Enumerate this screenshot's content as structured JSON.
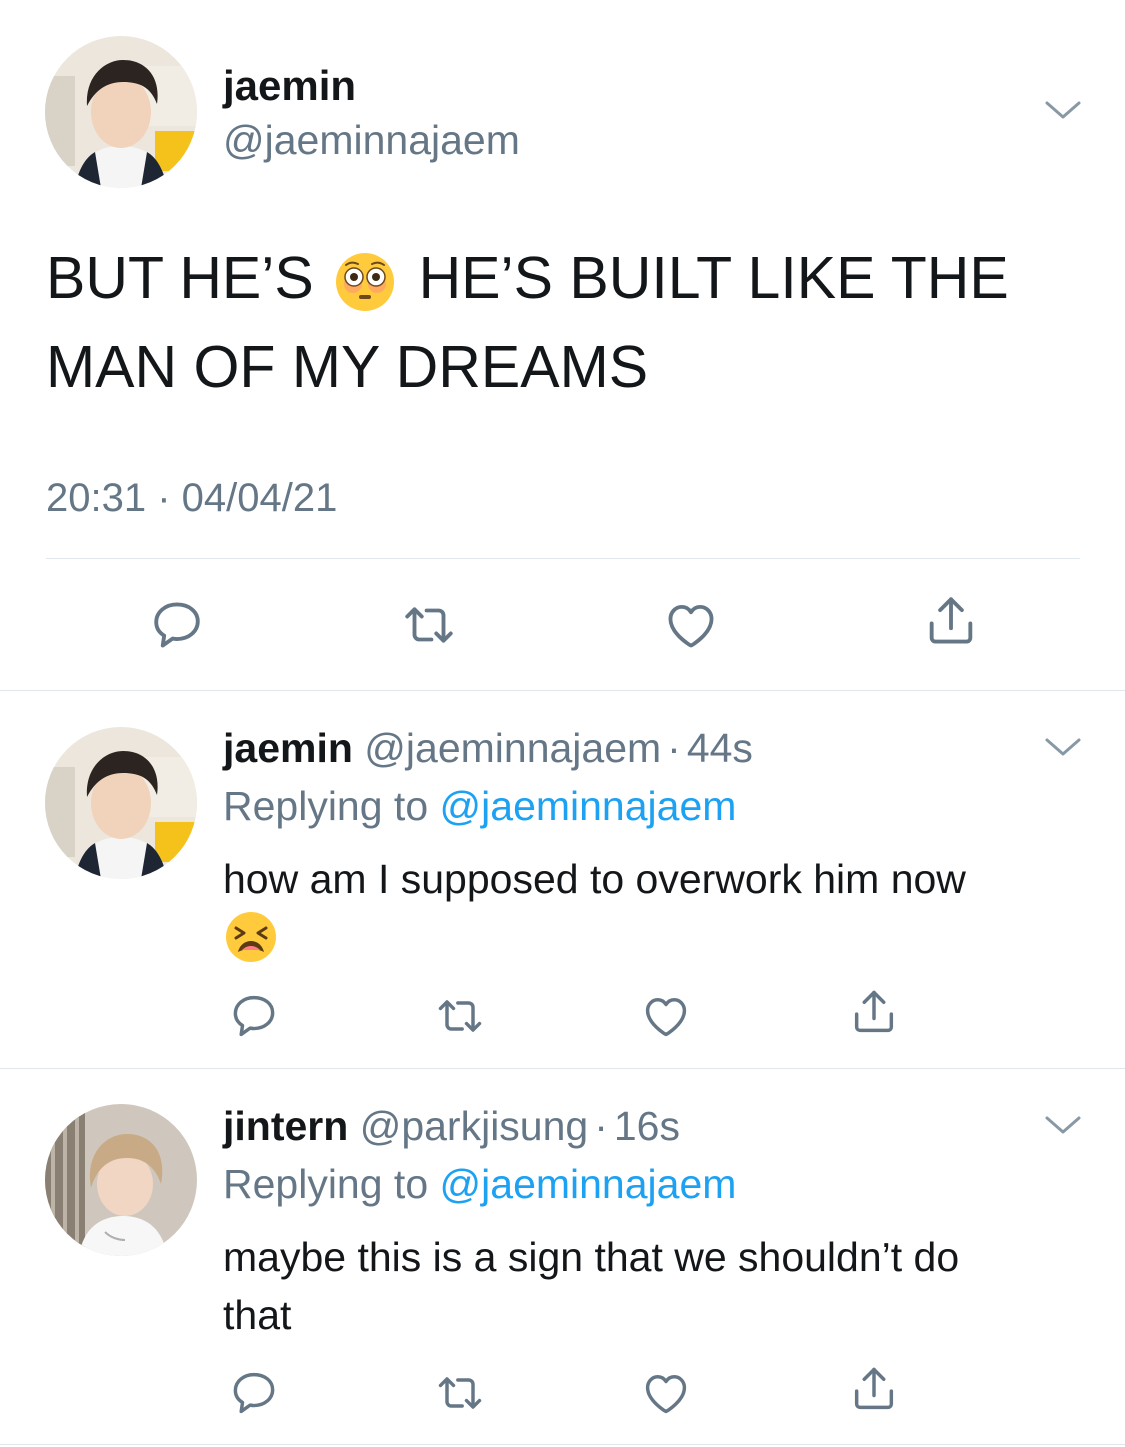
{
  "main_tweet": {
    "display_name": "jaemin",
    "handle": "@jaeminnajaem",
    "text_part1": "BUT HE’S",
    "text_emoji": "flushed-face-emoji",
    "text_part2": "HE’S BUILT LIKE THE",
    "text_line2": "MAN OF MY DREAMS",
    "timestamp": "20:31 · 04/04/21"
  },
  "replies": [
    {
      "display_name": "jaemin",
      "handle": "@jaeminnajaem",
      "sep": "·",
      "time": "44s",
      "replying_prefix": "Replying to",
      "replying_handle": "@jaeminnajaem",
      "text": "how am I supposed to overwork him now",
      "text_emoji": "tired-face-emoji"
    },
    {
      "display_name": "jintern",
      "handle": "@parkjisung",
      "sep": "·",
      "time": "16s",
      "replying_prefix": "Replying to",
      "replying_handle": "@jaeminnajaem",
      "text_line1": "maybe this is a sign that we shouldn’t do",
      "text_line2": "that"
    }
  ],
  "icons": {
    "reply": "reply-icon",
    "retweet": "retweet-icon",
    "like": "heart-icon",
    "share": "share-icon",
    "menu": "chevron-down-icon"
  },
  "colors": {
    "text": "#14171a",
    "secondary": "#657786",
    "link": "#1da1f2",
    "divider": "#e1e8ed"
  }
}
